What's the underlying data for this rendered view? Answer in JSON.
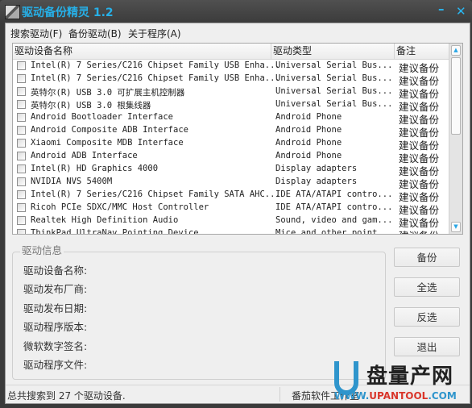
{
  "window": {
    "title": "驱动备份精灵 1.2",
    "icon": "app-film-icon",
    "minimize_label": "–",
    "close_label": "✕"
  },
  "menu": [
    {
      "label": "搜索驱动(F)"
    },
    {
      "label": "备份驱动(B)"
    },
    {
      "label": "关于程序(A)"
    }
  ],
  "list": {
    "columns": [
      "驱动设备名称",
      "驱动类型",
      "备注"
    ],
    "rows": [
      {
        "checked": false,
        "name": "Intel(R) 7 Series/C216 Chipset Family USB Enha...",
        "type": "Universal Serial Bus...",
        "note": "建议备份"
      },
      {
        "checked": false,
        "name": "Intel(R) 7 Series/C216 Chipset Family USB Enha...",
        "type": "Universal Serial Bus...",
        "note": "建议备份"
      },
      {
        "checked": false,
        "name": "英特尔(R) USB 3.0 可扩展主机控制器",
        "type": "Universal Serial Bus...",
        "note": "建议备份"
      },
      {
        "checked": false,
        "name": "英特尔(R) USB 3.0 根集线器",
        "type": "Universal Serial Bus...",
        "note": "建议备份"
      },
      {
        "checked": false,
        "name": "Android Bootloader Interface",
        "type": "Android Phone",
        "note": "建议备份"
      },
      {
        "checked": false,
        "name": "Android Composite ADB Interface",
        "type": "Android Phone",
        "note": "建议备份"
      },
      {
        "checked": false,
        "name": "Xiaomi Composite MDB Interface",
        "type": "Android Phone",
        "note": "建议备份"
      },
      {
        "checked": false,
        "name": "Android ADB Interface",
        "type": "Android Phone",
        "note": "建议备份"
      },
      {
        "checked": false,
        "name": "Intel(R) HD Graphics 4000",
        "type": "Display adapters",
        "note": "建议备份"
      },
      {
        "checked": false,
        "name": "NVIDIA NVS 5400M",
        "type": "Display adapters",
        "note": "建议备份"
      },
      {
        "checked": false,
        "name": "Intel(R) 7 Series/C216 Chipset Family SATA AHC...",
        "type": "IDE ATA/ATAPI contro...",
        "note": "建议备份"
      },
      {
        "checked": false,
        "name": "Ricoh PCIe SDXC/MMC Host Controller",
        "type": "IDE ATA/ATAPI contro...",
        "note": "建议备份"
      },
      {
        "checked": false,
        "name": "Realtek High Definition Audio",
        "type": "Sound, video and gam...",
        "note": "建议备份"
      },
      {
        "checked": false,
        "name": "ThinkPad UltraNav Pointing Device",
        "type": "Mice and other point...",
        "note": "建议备份"
      }
    ],
    "scroll": {
      "thumb_position_fraction": 0.0,
      "visible_fraction": 0.5
    }
  },
  "info": {
    "title": "驱动信息",
    "fields": [
      {
        "label": "驱动设备名称:",
        "value": ""
      },
      {
        "label": "驱动发布厂商:",
        "value": ""
      },
      {
        "label": "驱动发布日期:",
        "value": ""
      },
      {
        "label": "驱动程序版本:",
        "value": ""
      },
      {
        "label": "微软数字签名:",
        "value": ""
      },
      {
        "label": "驱动程序文件:",
        "value": ""
      }
    ]
  },
  "buttons": {
    "backup": "备份",
    "select_all": "全选",
    "invert": "反选",
    "exit": "退出"
  },
  "status": {
    "left": "总共搜索到 27 个驱动设备.",
    "right": "番茄软件工作室"
  },
  "watermark": {
    "brand_cn": "盘量产网",
    "url_prefix": "WWW.",
    "url_mid": "UPANTOOL",
    "url_suffix": ".COM"
  }
}
